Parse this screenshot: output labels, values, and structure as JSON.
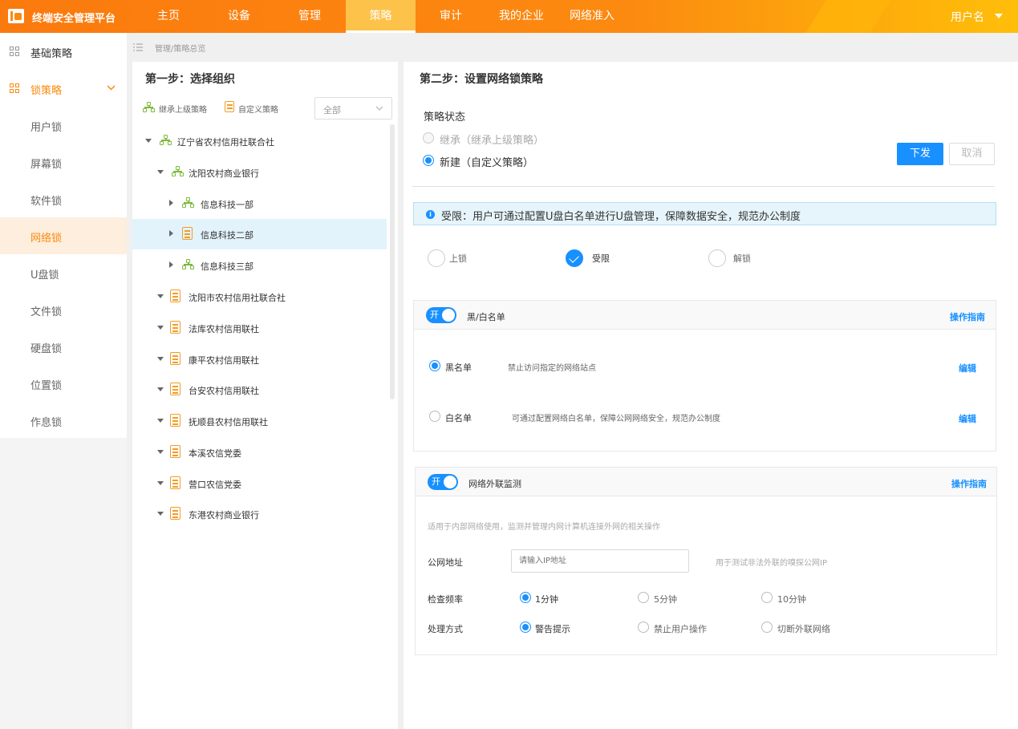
{
  "header": {
    "brand": "终端安全管理平台",
    "nav": [
      {
        "label": "主页"
      },
      {
        "label": "设备"
      },
      {
        "label": "管理"
      },
      {
        "label": "策略",
        "active": true
      },
      {
        "label": "审计"
      },
      {
        "label": "我的企业"
      },
      {
        "label": "网络准入"
      }
    ],
    "user": "用户名",
    "accent": "#fc8a10"
  },
  "sidebar": {
    "top": [
      {
        "label": "基础策略"
      },
      {
        "label": "锁策略",
        "expanded": true
      }
    ],
    "sub": [
      {
        "label": "用户锁"
      },
      {
        "label": "屏幕锁"
      },
      {
        "label": "软件锁"
      },
      {
        "label": "网络锁",
        "active": true
      },
      {
        "label": "U盘锁"
      },
      {
        "label": "文件锁"
      },
      {
        "label": "硬盘锁"
      },
      {
        "label": "位置锁"
      },
      {
        "label": "作息锁"
      }
    ]
  },
  "breadcrumb": "管理/策略总览",
  "step1": {
    "title": "第一步：选择组织",
    "inherit_label": "继承上级策略",
    "custom_label": "自定义策略",
    "filter_value": "全部",
    "tree": [
      {
        "label": "辽宁省农村信用社联合社",
        "icon": "org"
      },
      {
        "label": "沈阳农村商业银行",
        "icon": "org"
      },
      {
        "label": "信息科技一部",
        "icon": "org"
      },
      {
        "label": "信息科技二部",
        "icon": "doc",
        "selected": true
      },
      {
        "label": "信息科技三部",
        "icon": "org"
      },
      {
        "label": "沈阳市农村信用社联合社",
        "icon": "doc"
      },
      {
        "label": "法库农村信用联社",
        "icon": "doc"
      },
      {
        "label": "康平农村信用联社",
        "icon": "doc"
      },
      {
        "label": "台安农村信用联社",
        "icon": "doc"
      },
      {
        "label": "抚顺县农村信用联社",
        "icon": "doc"
      },
      {
        "label": "本溪农信党委",
        "icon": "doc"
      },
      {
        "label": "营口农信党委",
        "icon": "doc"
      },
      {
        "label": "东港农村商业银行",
        "icon": "doc"
      }
    ]
  },
  "step2": {
    "title": "第二步：设置网络锁策略",
    "status_label": "策略状态",
    "opt_inherit": "继承（继承上级策略）",
    "opt_new": "新建（自定义策略）",
    "btn_submit": "下发",
    "btn_cancel": "取消",
    "info": "受限：用户可通过配置U盘白名单进行U盘管理，保障数据安全，规范办公制度",
    "modes": [
      {
        "label": "上锁"
      },
      {
        "label": "受限",
        "checked": true
      },
      {
        "label": "解锁"
      }
    ],
    "bw": {
      "switch_label": "开",
      "title": "黑/白名单",
      "guide": "操作指南",
      "black_label": "黑名单",
      "black_desc": "禁止访问指定的网络站点",
      "white_label": "白名单",
      "white_desc": "可通过配置网络白名单，保障公网网络安全，规范办公制度",
      "edit": "编辑"
    },
    "monitor": {
      "switch_label": "开",
      "title": "网络外联监测",
      "guide": "操作指南",
      "desc": "适用于内部网络使用，监测并管理内网计算机连接外网的相关操作",
      "ip_label": "公网地址",
      "ip_placeholder": "请输入IP地址",
      "ip_hint": "用于测试非法外联的嗅探公网IP",
      "freq_label": "检查频率",
      "freq_opts": [
        "1分钟",
        "5分钟",
        "10分钟"
      ],
      "action_label": "处理方式",
      "action_opts": [
        "警告提示",
        "禁止用户操作",
        "切断外联网络"
      ]
    }
  }
}
